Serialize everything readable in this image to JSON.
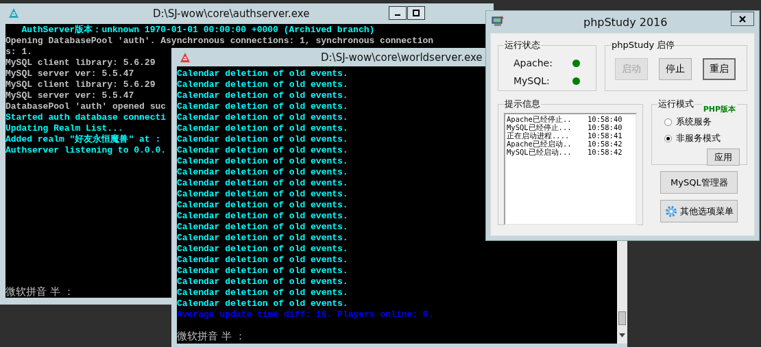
{
  "auth_window": {
    "title": "D:\\SJ-wow\\core\\authserver.exe",
    "lines": [
      {
        "text": "   AuthServer版本：unknown 1970-01-01 00:00:00 +0000 (Archived branch)",
        "kind": "highlight"
      },
      {
        "text": "Opening DatabasePool 'auth'. Asynchronous connections: 1, synchronous connection",
        "kind": "info"
      },
      {
        "text": "s: 1.",
        "kind": "info"
      },
      {
        "text": "MySQL client library: 5.6.29",
        "kind": "info"
      },
      {
        "text": "MySQL server ver: 5.5.47",
        "kind": "info"
      },
      {
        "text": "MySQL client library: 5.6.29",
        "kind": "info"
      },
      {
        "text": "MySQL server ver: 5.5.47",
        "kind": "info"
      },
      {
        "text": "DatabasePool 'auth' opened suc",
        "kind": "info"
      },
      {
        "text": "Started auth database connecti",
        "kind": "highlight"
      },
      {
        "text": "Updating Realm List...",
        "kind": "highlight"
      },
      {
        "text": "Added realm \"好友永恒魔兽\" at :",
        "kind": "highlight"
      },
      {
        "text": "Authserver listening to 0.0.0.",
        "kind": "highlight"
      }
    ],
    "ime_status": "微软拼音 半 ："
  },
  "world_window": {
    "title": "D:\\SJ-wow\\core\\worldserver.exe",
    "lines": [
      {
        "text": "Calendar deletion of old events.",
        "kind": "highlight"
      },
      {
        "text": "Calendar deletion of old events.",
        "kind": "highlight"
      },
      {
        "text": "Calendar deletion of old events.",
        "kind": "highlight"
      },
      {
        "text": "Calendar deletion of old events.",
        "kind": "highlight"
      },
      {
        "text": "Calendar deletion of old events.",
        "kind": "highlight"
      },
      {
        "text": "Calendar deletion of old events.",
        "kind": "highlight"
      },
      {
        "text": "Calendar deletion of old events.",
        "kind": "highlight"
      },
      {
        "text": "Calendar deletion of old events.",
        "kind": "highlight"
      },
      {
        "text": "Calendar deletion of old events.",
        "kind": "highlight"
      },
      {
        "text": "Calendar deletion of old events.",
        "kind": "highlight"
      },
      {
        "text": "Calendar deletion of old events.",
        "kind": "highlight"
      },
      {
        "text": "Calendar deletion of old events.",
        "kind": "highlight"
      },
      {
        "text": "Calendar deletion of old events.",
        "kind": "highlight"
      },
      {
        "text": "Calendar deletion of old events.",
        "kind": "highlight"
      },
      {
        "text": "Calendar deletion of old events.",
        "kind": "highlight"
      },
      {
        "text": "Calendar deletion of old events.",
        "kind": "highlight"
      },
      {
        "text": "Calendar deletion of old events.",
        "kind": "highlight"
      },
      {
        "text": "Calendar deletion of old events.",
        "kind": "highlight"
      },
      {
        "text": "Calendar deletion of old events.",
        "kind": "highlight"
      },
      {
        "text": "Calendar deletion of old events.",
        "kind": "highlight"
      },
      {
        "text": "Calendar deletion of old events.",
        "kind": "highlight"
      },
      {
        "text": "Calendar deletion of old events.",
        "kind": "highlight"
      },
      {
        "text": "Average update time diff: 16. Players online: 0.",
        "kind": "stats"
      }
    ],
    "ime_status": "微软拼音 半 ："
  },
  "phpstudy": {
    "title": "phpStudy 2016",
    "status_group": {
      "label": "运行状态",
      "services": [
        {
          "name": "Apache:",
          "color": "#008000"
        },
        {
          "name": "MySQL:",
          "color": "#008000"
        }
      ]
    },
    "control_group": {
      "label": "phpStudy 启停",
      "buttons": [
        {
          "label": "启动",
          "disabled": true,
          "default": false
        },
        {
          "label": "停止",
          "disabled": false,
          "default": false
        },
        {
          "label": "重启",
          "disabled": false,
          "default": true
        }
      ]
    },
    "log_group": {
      "label": "提示信息",
      "entries": [
        {
          "message": "Apache已经停止..",
          "time": "10:58:40"
        },
        {
          "message": "MySQL已经停止...",
          "time": "10:58:40"
        },
        {
          "message": "正在启动进程....",
          "time": "10:58:41"
        },
        {
          "message": "Apache已经启动..",
          "time": "10:58:42"
        },
        {
          "message": "MySQL已经启动...",
          "time": "10:58:42"
        }
      ]
    },
    "mode_group": {
      "label": "运行模式",
      "version_label": "PHP版本",
      "options": [
        {
          "label": "系统服务",
          "selected": false
        },
        {
          "label": "非服务模式",
          "selected": true
        }
      ],
      "apply_button": "应用"
    },
    "buttons": [
      {
        "label": "MySQL管理器",
        "kind": "plain"
      },
      {
        "label": "其他选项菜单",
        "kind": "menu"
      }
    ]
  }
}
